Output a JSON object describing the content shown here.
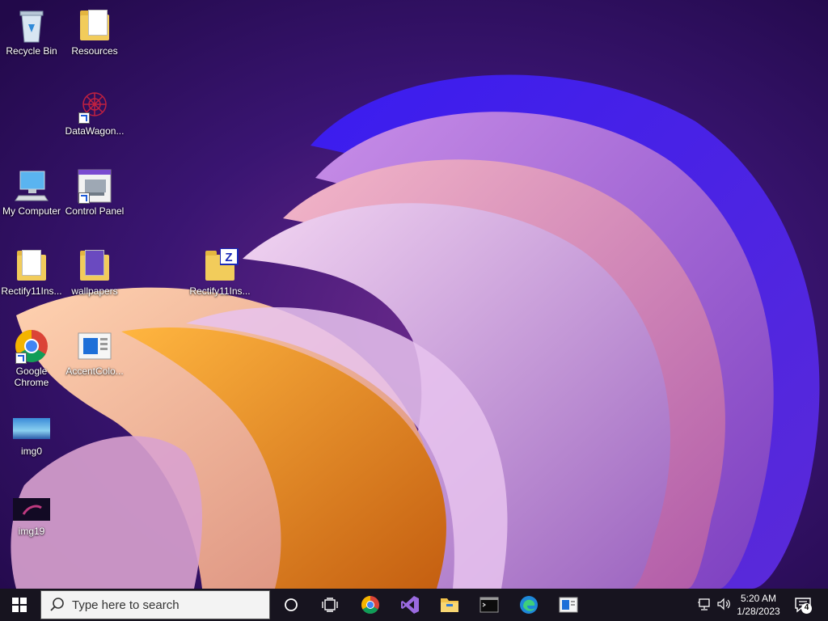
{
  "desktop": {
    "icons": [
      {
        "label": "Recycle Bin",
        "name": "recycle-bin-icon"
      },
      {
        "label": "Resources",
        "name": "folder-icon"
      },
      {
        "label": "DataWagon...",
        "name": "datawagon-icon"
      },
      {
        "label": "My Computer",
        "name": "computer-icon"
      },
      {
        "label": "Control Panel",
        "name": "control-panel-icon"
      },
      {
        "label": "Rectify11Ins...",
        "name": "folder-icon"
      },
      {
        "label": "wallpapers",
        "name": "folder-icon"
      },
      {
        "label": "Rectify11Ins...",
        "name": "zip-folder-icon"
      },
      {
        "label": "Google Chrome",
        "name": "chrome-icon"
      },
      {
        "label": "AccentColo...",
        "name": "app-window-icon"
      },
      {
        "label": "img0",
        "name": "image-thumbnail-icon"
      },
      {
        "label": "img19",
        "name": "image-thumbnail-icon"
      }
    ]
  },
  "taskbar": {
    "search_placeholder": "Type here to search",
    "pinned": [
      {
        "name": "cortana-icon"
      },
      {
        "name": "task-view-icon"
      },
      {
        "name": "chrome-icon"
      },
      {
        "name": "visual-studio-icon"
      },
      {
        "name": "file-explorer-icon"
      },
      {
        "name": "terminal-icon"
      },
      {
        "name": "edge-icon"
      },
      {
        "name": "app-window-icon"
      }
    ],
    "clock": {
      "time": "5:20 AM",
      "date": "1/28/2023"
    },
    "notification_count": "4"
  },
  "colors": {
    "taskbar_bg": "#17141f",
    "wallpaper_bg": "#2a0e5a",
    "accent_purple": "#5a2bd8",
    "accent_orange": "#f0a030"
  }
}
